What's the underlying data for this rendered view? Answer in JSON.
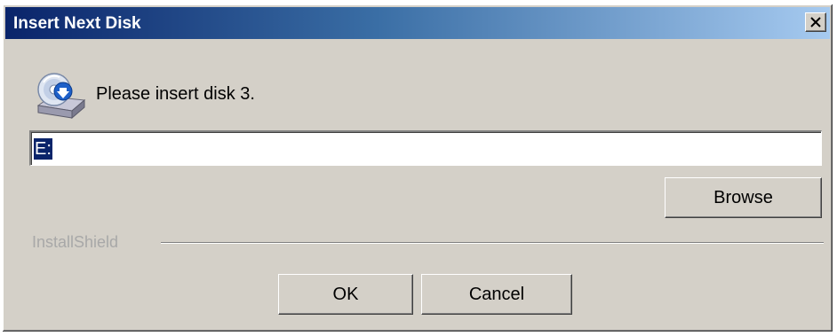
{
  "window": {
    "title": "Insert Next Disk",
    "close_icon": "close-icon"
  },
  "content": {
    "icon": "disk-drive-icon",
    "message": "Please insert disk 3.",
    "path_value": "E:",
    "browse_label": "Browse"
  },
  "branding": {
    "label": "InstallShield"
  },
  "buttons": {
    "ok_label": "OK",
    "cancel_label": "Cancel"
  },
  "colors": {
    "title_start": "#0a246a",
    "title_end": "#a6caf0",
    "dialog_bg": "#d4d0c8",
    "selection": "#0a246a"
  }
}
